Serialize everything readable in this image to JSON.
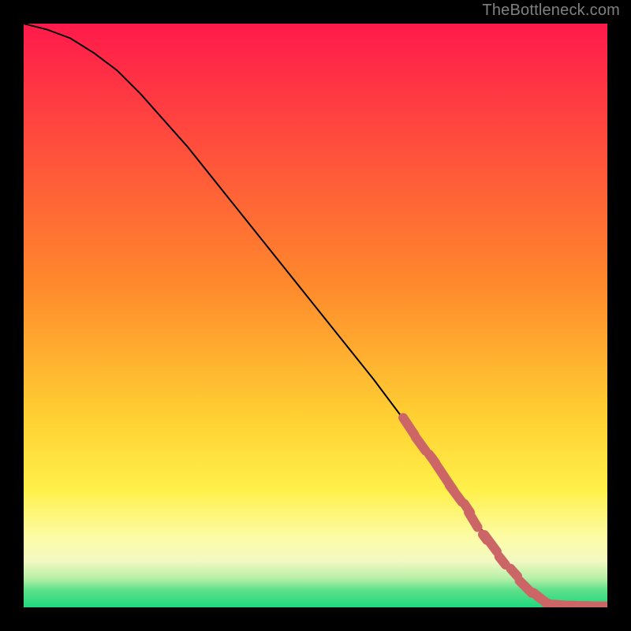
{
  "attribution": "TheBottleneck.com",
  "chart_data": {
    "type": "line",
    "title": "",
    "xlabel": "",
    "ylabel": "",
    "xlim": [
      0,
      100
    ],
    "ylim": [
      0,
      100
    ],
    "gradient_stops": [
      {
        "offset": 0,
        "color": "#ff1a4b"
      },
      {
        "offset": 45,
        "color": "#ff8a2c"
      },
      {
        "offset": 68,
        "color": "#ffd233"
      },
      {
        "offset": 80,
        "color": "#fff04a"
      },
      {
        "offset": 88,
        "color": "#fdfca6"
      },
      {
        "offset": 92,
        "color": "#f2f9c2"
      },
      {
        "offset": 95,
        "color": "#b8f0a8"
      },
      {
        "offset": 97,
        "color": "#5fe08a"
      },
      {
        "offset": 100,
        "color": "#1fd77f"
      }
    ],
    "series": [
      {
        "name": "bottleneck-curve",
        "color": "#000000",
        "x": [
          0,
          4,
          8,
          12,
          16,
          20,
          28,
          36,
          44,
          52,
          60,
          66,
          72,
          76,
          80,
          84,
          88,
          92,
          96,
          100
        ],
        "y": [
          100,
          99,
          97.5,
          95,
          92,
          88,
          79,
          69,
          59,
          49,
          39,
          31,
          23,
          17,
          11,
          6,
          2,
          0.5,
          0.2,
          0.2
        ]
      }
    ],
    "markers": {
      "name": "highlight-dots",
      "color": "#cc6666",
      "radius": 6,
      "points": [
        {
          "x": 66,
          "y": 31,
          "len": 6
        },
        {
          "x": 68,
          "y": 28,
          "len": 5
        },
        {
          "x": 70,
          "y": 25.5,
          "len": 3
        },
        {
          "x": 71,
          "y": 24,
          "len": 7
        },
        {
          "x": 73,
          "y": 21,
          "len": 4
        },
        {
          "x": 74,
          "y": 19.5,
          "len": 6
        },
        {
          "x": 76,
          "y": 17,
          "len": 3
        },
        {
          "x": 77,
          "y": 15,
          "len": 5
        },
        {
          "x": 79,
          "y": 12,
          "len": 2
        },
        {
          "x": 80,
          "y": 11,
          "len": 6
        },
        {
          "x": 82,
          "y": 8,
          "len": 3
        },
        {
          "x": 84,
          "y": 6,
          "len": 3
        },
        {
          "x": 86,
          "y": 3.5,
          "len": 5
        },
        {
          "x": 88,
          "y": 2,
          "len": 3
        },
        {
          "x": 89,
          "y": 1.2,
          "len": 4
        },
        {
          "x": 90,
          "y": 0.6,
          "len": 2
        },
        {
          "x": 92,
          "y": 0.4,
          "len": 4
        },
        {
          "x": 94,
          "y": 0.3,
          "len": 2
        },
        {
          "x": 96,
          "y": 0.25,
          "len": 3
        },
        {
          "x": 98,
          "y": 0.2,
          "len": 3
        },
        {
          "x": 100,
          "y": 0.2,
          "len": 2
        }
      ]
    }
  }
}
